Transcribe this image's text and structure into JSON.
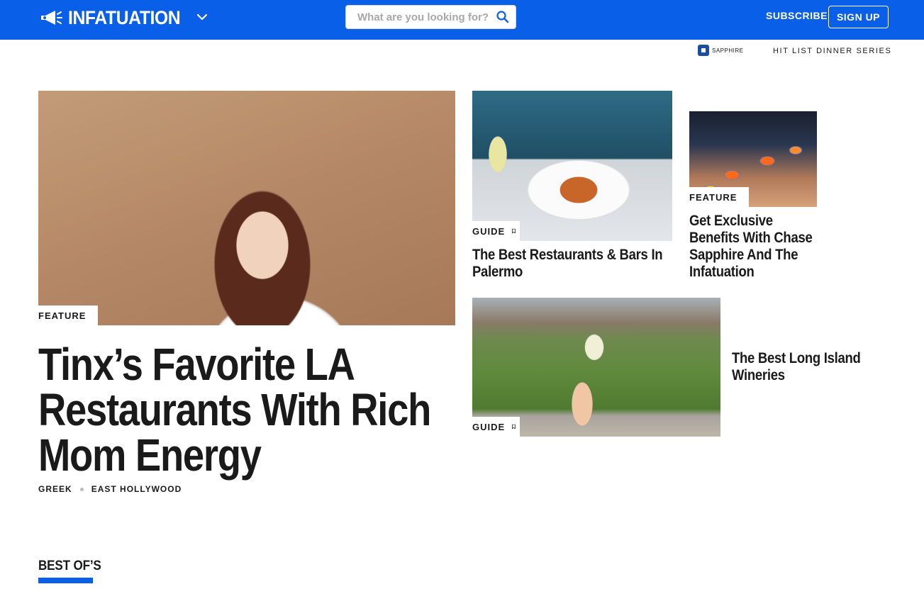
{
  "header": {
    "logo_text": "INFATUATION",
    "search_placeholder": "What are you looking for?",
    "subscribe_label": "SUBSCRIBE",
    "signup_label": "SIGN UP"
  },
  "subnav": {
    "sapphire_label": "SAPPHIRE",
    "hitlist_label": "HIT LIST DINNER SERIES"
  },
  "hero": {
    "tag": "FEATURE",
    "title": "Tinx’s Favorite LA Restaurants With Rich Mom Energy",
    "meta": [
      "GREEK",
      "EAST HOLLYWOOD"
    ]
  },
  "cards": [
    {
      "tag": "GUIDE",
      "title": "The Best Restaurants & Bars In Palermo"
    },
    {
      "tag": "FEATURE",
      "title": "Get Exclusive Benefits With Chase Sapphire And The Infatuation"
    },
    {
      "tag": "GUIDE",
      "title": "The Best Long Island Wineries"
    }
  ],
  "sections": {
    "best_ofs": "BEST OF’S"
  },
  "colors": {
    "brand_blue": "#0a5fe8",
    "text": "#1a1a1a"
  }
}
